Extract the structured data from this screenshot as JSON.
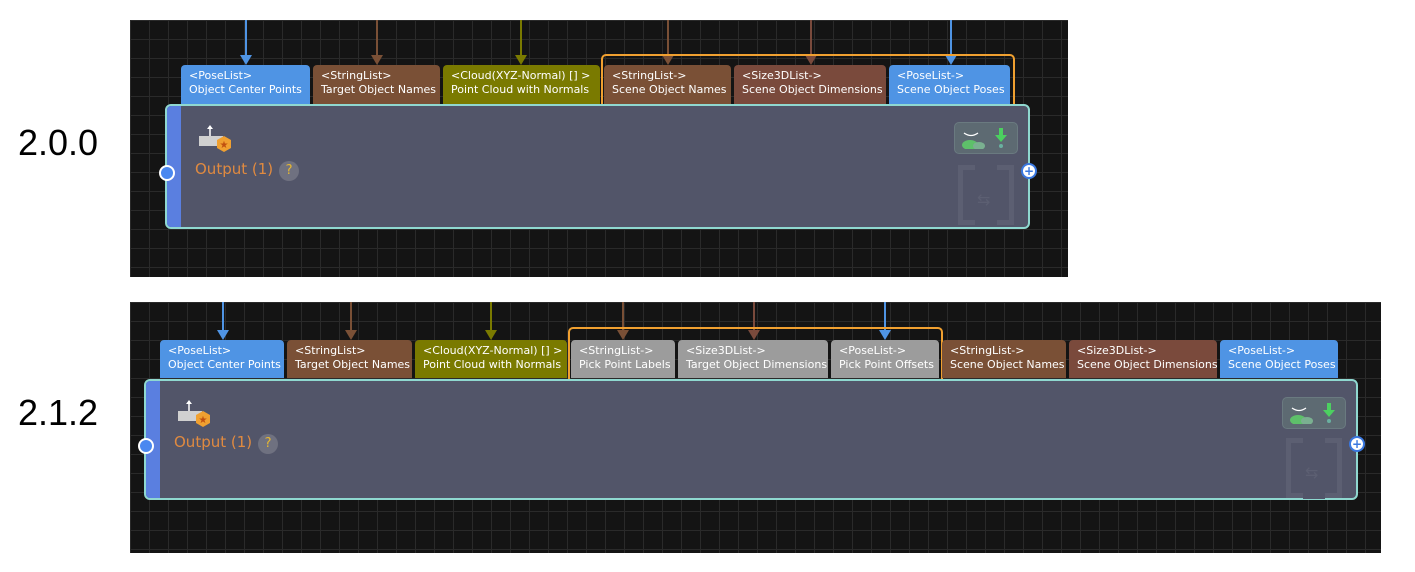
{
  "versions": [
    {
      "label": "2.0.0",
      "tabs": [
        {
          "type": "<PoseList>",
          "name": "Object Center Points",
          "color": "#4f94e4"
        },
        {
          "type": "<StringList>",
          "name": "Target Object Names",
          "color": "#7a5036"
        },
        {
          "type": "<Cloud(XYZ-Normal) [] >",
          "name": "Point Cloud with Normals",
          "color": "#7a7a00"
        },
        {
          "type": "<StringList->",
          "name": "Scene Object Names",
          "color": "#7a5036"
        },
        {
          "type": "<Size3DList->",
          "name": "Scene Object Dimensions",
          "color": "#7a4a3c"
        },
        {
          "type": "<PoseList->",
          "name": "Scene Object Poses",
          "color": "#4f94e4"
        }
      ],
      "node": {
        "title": "Output (1)",
        "help": "?"
      }
    },
    {
      "label": "2.1.2",
      "tabs": [
        {
          "type": "<PoseList>",
          "name": "Object Center Points",
          "color": "#4f94e4"
        },
        {
          "type": "<StringList>",
          "name": "Target Object Names",
          "color": "#7a5036"
        },
        {
          "type": "<Cloud(XYZ-Normal) [] >",
          "name": "Point Cloud with Normals",
          "color": "#7a7a00"
        },
        {
          "type": "<StringList->",
          "name": "Pick Point Labels",
          "color": "#9c9c9c"
        },
        {
          "type": "<Size3DList->",
          "name": "Target Object Dimensions",
          "color": "#9c9c9c"
        },
        {
          "type": "<PoseList->",
          "name": "Pick Point Offsets",
          "color": "#9c9c9c"
        },
        {
          "type": "<StringList->",
          "name": "Scene Object Names",
          "color": "#7a5036"
        },
        {
          "type": "<Size3DList->",
          "name": "Scene Object Dimensions",
          "color": "#7a4a3c"
        },
        {
          "type": "<PoseList->",
          "name": "Scene Object Poses",
          "color": "#4f94e4"
        }
      ],
      "node": {
        "title": "Output (1)",
        "help": "?"
      }
    }
  ],
  "colors": {
    "selection": "#f0a030",
    "node_border": "#8fd8d0",
    "node_bg": "#525569",
    "title": "#e08a40"
  },
  "icons": [
    "output-step-icon",
    "visualize-icon",
    "download-icon",
    "add-port-icon",
    "step-bracket-icon"
  ]
}
